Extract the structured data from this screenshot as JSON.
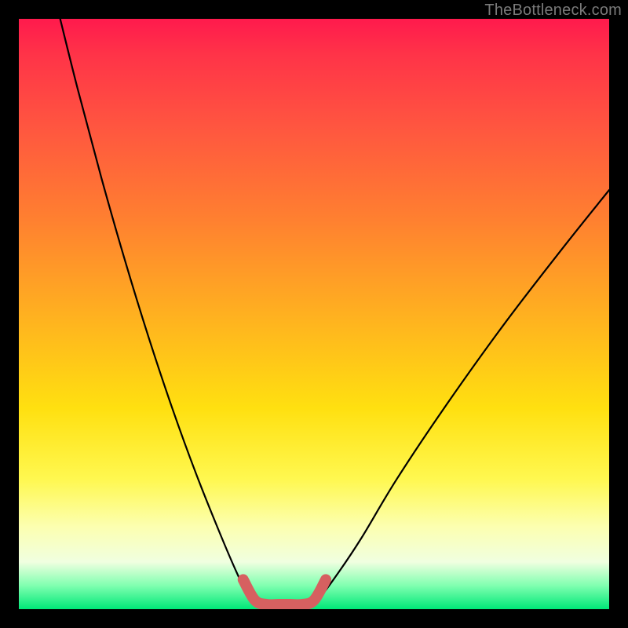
{
  "watermark": {
    "text": "TheBottleneck.com"
  },
  "chart_data": {
    "type": "line",
    "title": "",
    "xlabel": "",
    "ylabel": "",
    "xlim": [
      0,
      100
    ],
    "ylim": [
      0,
      100
    ],
    "grid": false,
    "series": [
      {
        "name": "left-curve",
        "x": [
          7,
          10,
          14,
          18,
          22,
          26,
          30,
          34,
          37,
          39,
          40.5
        ],
        "y": [
          100,
          88,
          73,
          59,
          46,
          34,
          23,
          13,
          6,
          2,
          0.5
        ]
      },
      {
        "name": "right-curve",
        "x": [
          49,
          51,
          54,
          58,
          64,
          72,
          82,
          92,
          100
        ],
        "y": [
          0.5,
          2,
          6,
          12,
          22,
          34,
          48,
          61,
          71
        ]
      },
      {
        "name": "flat-bottom-highlight",
        "x": [
          38,
          40,
          42,
          44,
          46,
          48,
          50,
          52
        ],
        "y": [
          5,
          1.5,
          0.8,
          0.8,
          0.8,
          0.8,
          1.5,
          5
        ]
      }
    ],
    "annotations": []
  },
  "colors": {
    "black_line": "#000000",
    "highlight_line": "#d66060"
  }
}
